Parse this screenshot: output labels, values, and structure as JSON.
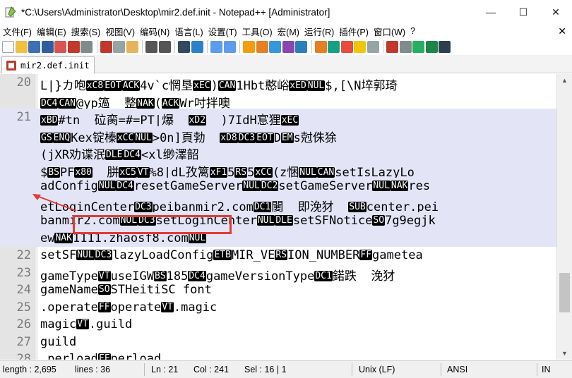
{
  "window": {
    "title": "*C:\\Users\\Administrator\\Desktop\\mir2.def.init - Notepad++ [Administrator]",
    "minimize": "—",
    "maximize": "☐",
    "close": "✕"
  },
  "menu": {
    "items": [
      "文件(F)",
      "编辑(E)",
      "搜索(S)",
      "视图(V)",
      "编码(N)",
      "语言(L)",
      "设置(T)",
      "工具(O)",
      "宏(M)",
      "运行(R)",
      "插件(P)",
      "窗口(W)",
      "?"
    ],
    "close_doc": "✕"
  },
  "tab": {
    "label": "mir2.def.init"
  },
  "editor": {
    "line_numbers": [
      "20",
      "21",
      "22",
      "23",
      "24",
      "25",
      "26",
      "27"
    ],
    "lines": [
      {
        "n": "20",
        "text": "L|}カ咆xC8EOTACK4v`c惘垦xEC)CAN1Hbt憨峪xEDNUL$,[\\N埣郭琦"
      },
      {
        "n": "",
        "text": "DC4CAN@yp簻  整NAK(ACKWr吋拌噢"
      },
      {
        "n": "21",
        "text": "xBD#tn  砬脔=#=PT|爆  xD2  )7IdH悹狸xEC"
      },
      {
        "n": "",
        "text": "GSENQKex锭榛xCCNUL>0n]頁勃  xD8DC3EOTDEMs尅侏狳"
      },
      {
        "n": "",
        "text": "(jXR劝谍泯DLEDC4<xl缈澤韶"
      },
      {
        "n": "",
        "text": "$BSPFx80  胼xC5VT%8|dL孜篱xF15RS5xCC(z悃NULCANsetIsLazyLo"
      },
      {
        "n": "",
        "text": "adConfigNULDC4resetGameServerNULDC2setGameServerNULNAKres"
      },
      {
        "n": "",
        "text": "etLoginCenterDC3peibanmir2.comDC1闄  即浼犲  SUBcenter.pei"
      },
      {
        "n": "",
        "text": "banmir2.comNULDC3setLoginCenterNULDLEsetSFNoticeSO7g9egjk"
      },
      {
        "n": "",
        "text": "ewNAK1111.zhaosf8.comNUL"
      },
      {
        "n": "22",
        "text": "setSFNULDC3lazyLoadConfigETBMIR_VERSION_NUMBERFFgametea"
      },
      {
        "n": "23",
        "text": "gameTypeVTuseIGWBS185DC4gameVersionTypeDC1鍩跌  浼犲"
      },
      {
        "n": "24",
        "text": "gameNameSOSTHeitiSC font"
      },
      {
        "n": "25",
        "text": ".operateFFoperateVT.magic"
      },
      {
        "n": "26",
        "text": "magicVT.guild"
      },
      {
        "n": "27",
        "text": "guild"
      },
      {
        "n": "28",
        "text": ".perloadFFperload"
      }
    ]
  },
  "status": {
    "length": "length : 2,695",
    "lines": "lines : 36",
    "ln": "Ln : 21",
    "col": "Col : 241",
    "sel": "Sel : 16 | 1",
    "eol": "Unix (LF)",
    "encoding": "ANSI",
    "mode": "IN"
  },
  "colors": {
    "selection": "#e3e5f7",
    "annotation": "#e53935"
  }
}
